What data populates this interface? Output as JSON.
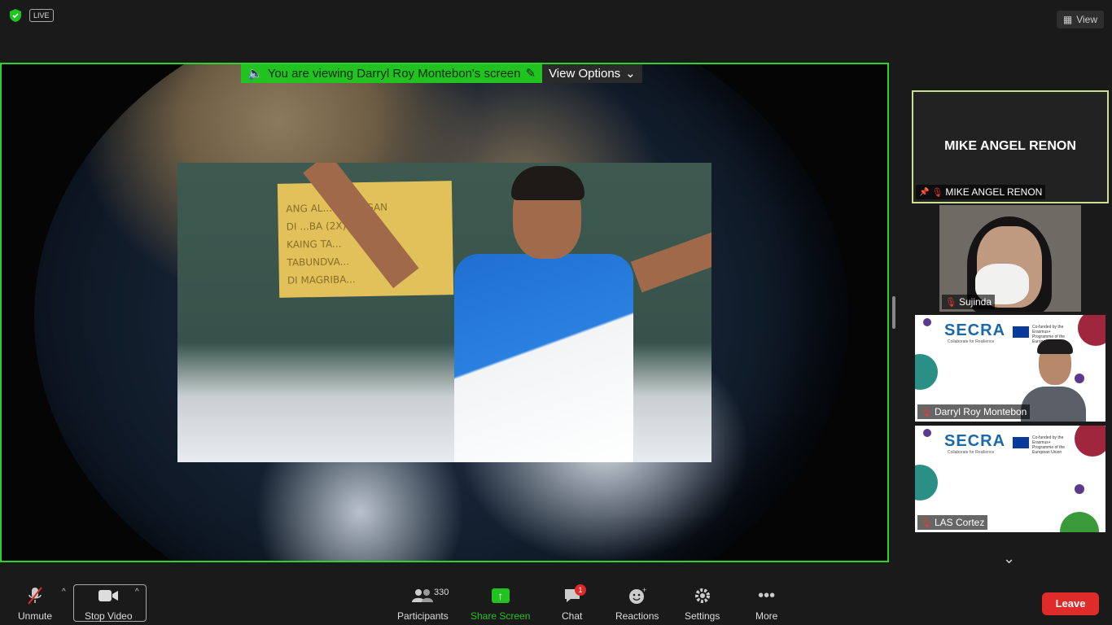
{
  "topbar": {
    "live_label": "LIVE",
    "view_label": "View"
  },
  "banner": {
    "viewing_text": "You are viewing Darryl Roy Montebon's screen",
    "view_options_label": "View Options"
  },
  "video": {
    "poster_lines": [
      "ANG AL... SANDIGAN",
      "DI ...BA (2X)",
      "KAING TA...",
      "TABUNDVA...",
      "DI MAGRIBA..."
    ]
  },
  "participants": {
    "active": {
      "name": "MIKE ANGEL RENON",
      "label": "MIKE ANGEL RENON"
    },
    "tiles": [
      {
        "name": "Sujinda"
      },
      {
        "name": "Darryl Roy Montebon",
        "logo": "SECRA",
        "logo_sub": "Collaborate for Resilience",
        "eu_text": "Co-funded by the Erasmus+ Programme of the European Union"
      },
      {
        "name": "LAS Cortez",
        "logo": "SECRA",
        "logo_sub": "Collaborate for Resilience",
        "eu_text": "Co-funded by the Erasmus+ Programme of the European Union"
      }
    ]
  },
  "toolbar": {
    "unmute": "Unmute",
    "stop_video": "Stop Video",
    "participants": "Participants",
    "participants_count": "330",
    "share_screen": "Share Screen",
    "chat": "Chat",
    "chat_badge": "1",
    "reactions": "Reactions",
    "settings": "Settings",
    "more": "More",
    "leave": "Leave"
  },
  "colors": {
    "accent_green": "#21c321",
    "leave_red": "#e02b2b"
  }
}
